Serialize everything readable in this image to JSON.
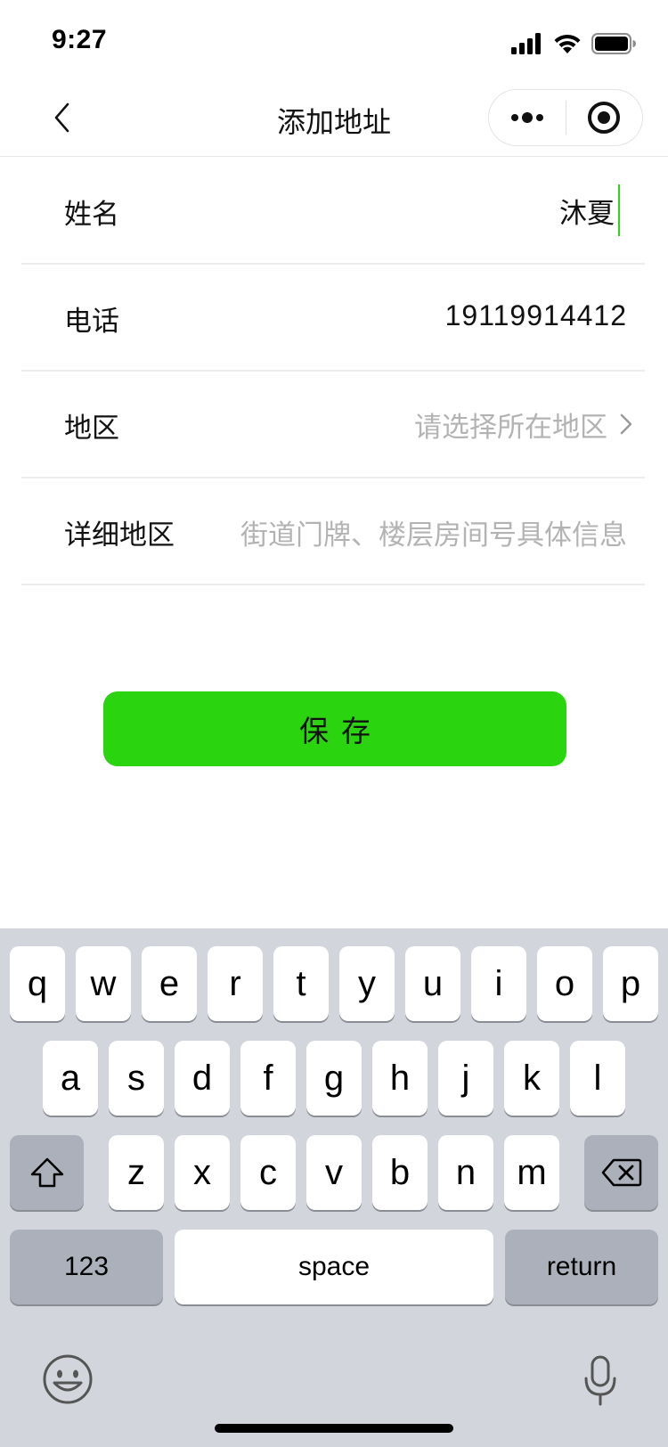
{
  "status_bar": {
    "time": "9:27"
  },
  "nav": {
    "title": "添加地址"
  },
  "form": {
    "name": {
      "label": "姓名",
      "value": "沐夏"
    },
    "phone": {
      "label": "电话",
      "value": "19119914412"
    },
    "region": {
      "label": "地区",
      "placeholder": "请选择所在地区"
    },
    "detail": {
      "label": "详细地区",
      "placeholder": "街道门牌、楼层房间号具体信息"
    }
  },
  "save_button": {
    "label": "保存",
    "color": "#2ad40f"
  },
  "keyboard": {
    "row1": [
      "q",
      "w",
      "e",
      "r",
      "t",
      "y",
      "u",
      "i",
      "o",
      "p"
    ],
    "row2": [
      "a",
      "s",
      "d",
      "f",
      "g",
      "h",
      "j",
      "k",
      "l"
    ],
    "row3": [
      "z",
      "x",
      "c",
      "v",
      "b",
      "n",
      "m"
    ],
    "numbers_label": "123",
    "space_label": "space",
    "return_label": "return"
  },
  "icons": [
    "back-chevron-icon",
    "more-dots-icon",
    "record-target-icon",
    "signal-icon",
    "wifi-icon",
    "battery-icon",
    "shift-icon",
    "backspace-icon",
    "emoji-icon",
    "microphone-icon"
  ]
}
